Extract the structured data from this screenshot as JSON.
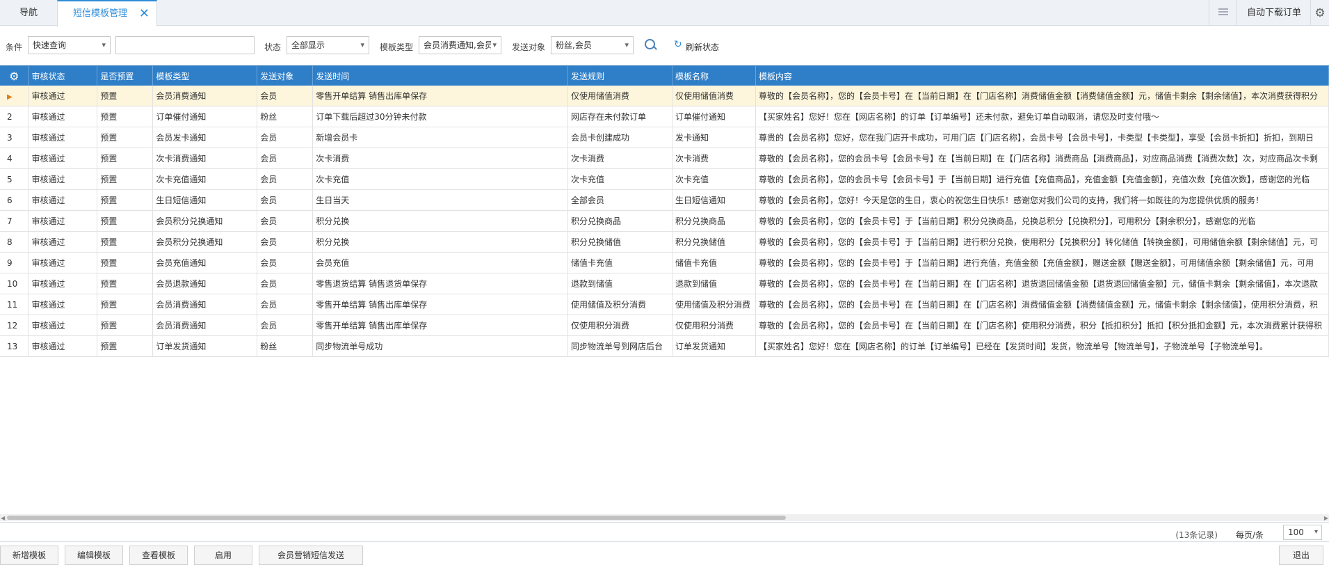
{
  "tabs": {
    "nav": "导航",
    "active": "短信模板管理",
    "auto_download": "自动下载订单"
  },
  "filters": {
    "condition_label": "条件",
    "condition_value": "快速查询",
    "status_label": "状态",
    "status_value": "全部显示",
    "template_type_label": "模板类型",
    "template_type_value": "会员消费通知,会员",
    "send_target_label": "发送对象",
    "send_target_value": "粉丝,会员",
    "refresh_label": "刷新状态"
  },
  "table": {
    "columns": [
      "审核状态",
      "是否预置",
      "模板类型",
      "发送对象",
      "发送时间",
      "发送规则",
      "模板名称",
      "模板内容"
    ],
    "rows": [
      {
        "n": "",
        "status": "审核通过",
        "preset": "预置",
        "type": "会员消费通知",
        "target": "会员",
        "time": "零售开单结算 销售出库单保存",
        "rule": "仅使用储值消费",
        "name": "仅使用储值消费",
        "content": "尊敬的【会员名称】，您的【会员卡号】在【当前日期】在【门店名称】消费储值金额【消费储值金额】元，储值卡剩余【剩余储值】，本次消费获得积分"
      },
      {
        "n": "2",
        "status": "审核通过",
        "preset": "预置",
        "type": "订单催付通知",
        "target": "粉丝",
        "time": "订单下载后超过30分钟未付款",
        "rule": "网店存在未付款订单",
        "name": "订单催付通知",
        "content": "【买家姓名】您好！您在【网店名称】的订单【订单编号】还未付款，避免订单自动取消，请您及时支付哦～"
      },
      {
        "n": "3",
        "status": "审核通过",
        "preset": "预置",
        "type": "会员发卡通知",
        "target": "会员",
        "time": "新增会员卡",
        "rule": "会员卡创建成功",
        "name": "发卡通知",
        "content": "尊贵的【会员名称】您好，您在我门店开卡成功，可用门店【门店名称】，会员卡号【会员卡号】，卡类型【卡类型】，享受【会员卡折扣】折扣，到期日"
      },
      {
        "n": "4",
        "status": "审核通过",
        "preset": "预置",
        "type": "次卡消费通知",
        "target": "会员",
        "time": "次卡消费",
        "rule": "次卡消费",
        "name": "次卡消费",
        "content": "尊敬的【会员名称】，您的会员卡号【会员卡号】在【当前日期】在【门店名称】消费商品【消费商品】，对应商品消费【消费次数】次，对应商品次卡剩"
      },
      {
        "n": "5",
        "status": "审核通过",
        "preset": "预置",
        "type": "次卡充值通知",
        "target": "会员",
        "time": "次卡充值",
        "rule": "次卡充值",
        "name": "次卡充值",
        "content": "尊敬的【会员名称】，您的会员卡号【会员卡号】于【当前日期】进行充值【充值商品】，充值金额【充值金额】，充值次数【充值次数】，感谢您的光临"
      },
      {
        "n": "6",
        "status": "审核通过",
        "preset": "预置",
        "type": "生日短信通知",
        "target": "会员",
        "time": "生日当天",
        "rule": "全部会员",
        "name": "生日短信通知",
        "content": "尊敬的【会员名称】，您好！今天是您的生日，衷心的祝您生日快乐！感谢您对我们公司的支持，我们将一如既往的为您提供优质的服务！"
      },
      {
        "n": "7",
        "status": "审核通过",
        "preset": "预置",
        "type": "会员积分兑换通知",
        "target": "会员",
        "time": "积分兑换",
        "rule": "积分兑换商品",
        "name": "积分兑换商品",
        "content": "尊敬的【会员名称】，您的【会员卡号】于【当前日期】积分兑换商品，兑换总积分【兑换积分】，可用积分【剩余积分】，感谢您的光临"
      },
      {
        "n": "8",
        "status": "审核通过",
        "preset": "预置",
        "type": "会员积分兑换通知",
        "target": "会员",
        "time": "积分兑换",
        "rule": "积分兑换储值",
        "name": "积分兑换储值",
        "content": "尊敬的【会员名称】，您的【会员卡号】于【当前日期】进行积分兑换，使用积分【兑换积分】转化储值【转换金额】，可用储值余额【剩余储值】元，可"
      },
      {
        "n": "9",
        "status": "审核通过",
        "preset": "预置",
        "type": "会员充值通知",
        "target": "会员",
        "time": "会员充值",
        "rule": "储值卡充值",
        "name": "储值卡充值",
        "content": "尊敬的【会员名称】，您的【会员卡号】于【当前日期】进行充值，充值金额【充值金额】，赠送金额【赠送金额】，可用储值余额【剩余储值】元，可用"
      },
      {
        "n": "10",
        "status": "审核通过",
        "preset": "预置",
        "type": "会员退款通知",
        "target": "会员",
        "time": "零售退货结算 销售退货单保存",
        "rule": "退款到储值",
        "name": "退款到储值",
        "content": "尊敬的【会员名称】，您的【会员卡号】在【当前日期】在【门店名称】退货退回储值金额【退货退回储值金额】元，储值卡剩余【剩余储值】，本次退款"
      },
      {
        "n": "11",
        "status": "审核通过",
        "preset": "预置",
        "type": "会员消费通知",
        "target": "会员",
        "time": "零售开单结算 销售出库单保存",
        "rule": "使用储值及积分消费",
        "name": "使用储值及积分消费",
        "content": "尊敬的【会员名称】，您的【会员卡号】在【当前日期】在【门店名称】消费储值金额【消费储值金额】元，储值卡剩余【剩余储值】，使用积分消费，积"
      },
      {
        "n": "12",
        "status": "审核通过",
        "preset": "预置",
        "type": "会员消费通知",
        "target": "会员",
        "time": "零售开单结算 销售出库单保存",
        "rule": "仅使用积分消费",
        "name": "仅使用积分消费",
        "content": "尊敬的【会员名称】，您的【会员卡号】在【当前日期】在【门店名称】使用积分消费，积分【抵扣积分】抵扣【积分抵扣金额】元，本次消费累计获得积"
      },
      {
        "n": "13",
        "status": "审核通过",
        "preset": "预置",
        "type": "订单发货通知",
        "target": "粉丝",
        "time": "同步物流单号成功",
        "rule": "同步物流单号到网店后台",
        "name": "订单发货通知",
        "content": "【买家姓名】您好！您在【网店名称】的订单【订单编号】已经在【发货时间】发货，物流单号【物流单号】，子物流单号【子物流单号】。"
      }
    ]
  },
  "pager": {
    "records": "(13条记录)",
    "per_page_label": "每页/条",
    "per_page_value": "100"
  },
  "buttons": {
    "add": "新增模板",
    "edit": "编辑模板",
    "view": "查看模板",
    "enable": "启用",
    "send": "会员营销短信发送",
    "exit": "退出"
  }
}
